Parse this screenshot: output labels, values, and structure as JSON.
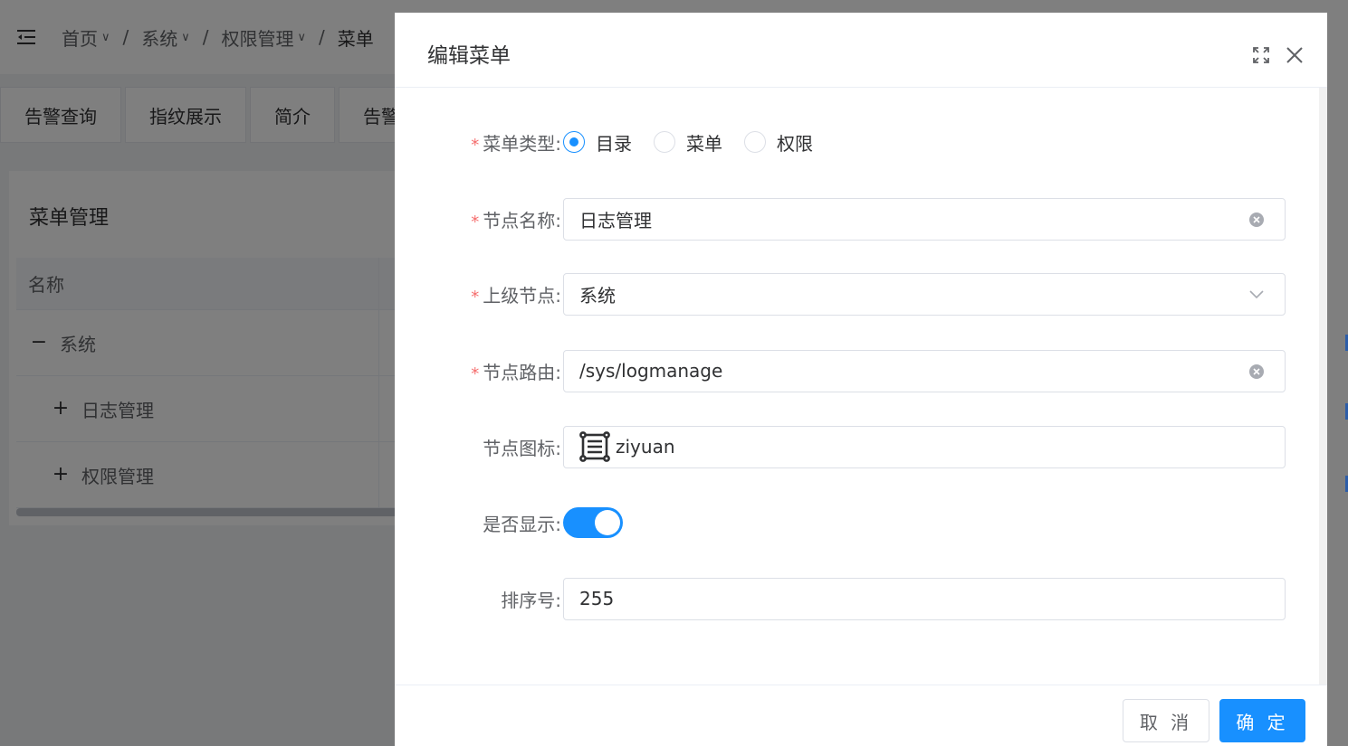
{
  "header": {
    "breadcrumb": [
      {
        "label": "首页"
      },
      {
        "label": "系统"
      },
      {
        "label": "权限管理"
      },
      {
        "label": "菜单"
      }
    ],
    "crumb_separator": "/"
  },
  "tabs": [
    "告警查询",
    "指纹展示",
    "简介",
    "告警"
  ],
  "card": {
    "title": "菜单管理",
    "table": {
      "column_name": "名称",
      "rows": [
        {
          "expander": "−",
          "label": "系统"
        },
        {
          "expander": "+",
          "label": "日志管理"
        },
        {
          "expander": "+",
          "label": "权限管理"
        }
      ]
    }
  },
  "dialog": {
    "title": "编辑菜单",
    "fields": {
      "menu_type": {
        "label": "菜单类型:",
        "required_mark": "*",
        "options": [
          "目录",
          "菜单",
          "权限"
        ],
        "selected": "目录"
      },
      "node_name": {
        "label": "节点名称:",
        "required_mark": "*",
        "value": "日志管理"
      },
      "parent_node": {
        "label": "上级节点:",
        "required_mark": "*",
        "value": "系统"
      },
      "node_route": {
        "label": "节点路由:",
        "required_mark": "*",
        "value": "/sys/logmanage"
      },
      "node_icon": {
        "label": "节点图标:",
        "value": "ziyuan",
        "icon": "ziyuan-icon"
      },
      "visible": {
        "label": "是否显示:",
        "value": true
      },
      "sort_order": {
        "label": "排序号:",
        "value": "255"
      }
    },
    "buttons": {
      "cancel": "取 消",
      "ok": "确 定"
    }
  },
  "colors": {
    "accent": "#1890ff",
    "required": "#f56c6c",
    "overlay": "rgba(0,0,0,0.5)"
  }
}
